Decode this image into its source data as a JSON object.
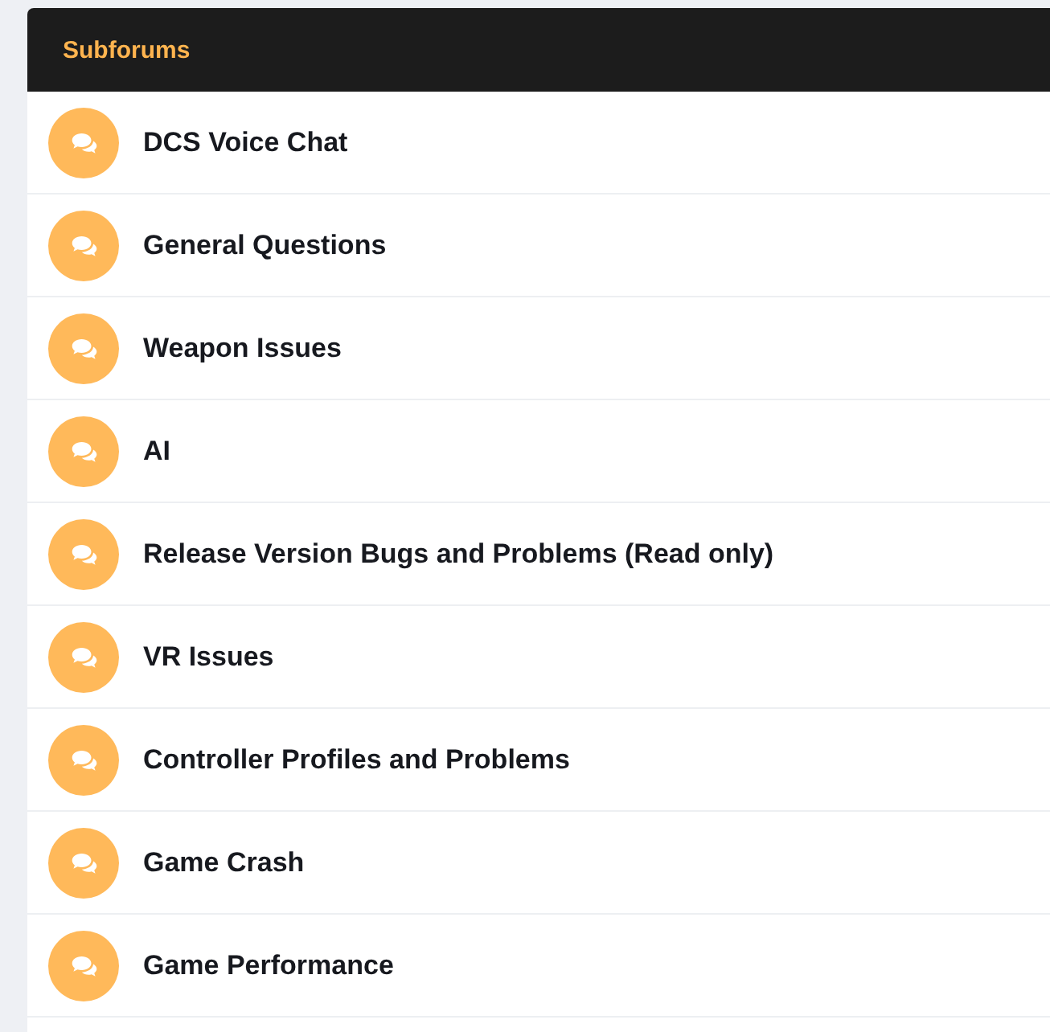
{
  "panel": {
    "title": "Subforums"
  },
  "subforums": [
    {
      "name": "DCS Voice Chat"
    },
    {
      "name": "General Questions"
    },
    {
      "name": "Weapon Issues"
    },
    {
      "name": "AI"
    },
    {
      "name": "Release Version Bugs and Problems (Read only)"
    },
    {
      "name": "VR Issues"
    },
    {
      "name": "Controller Profiles and Problems"
    },
    {
      "name": "Game Crash"
    },
    {
      "name": "Game Performance"
    }
  ]
}
